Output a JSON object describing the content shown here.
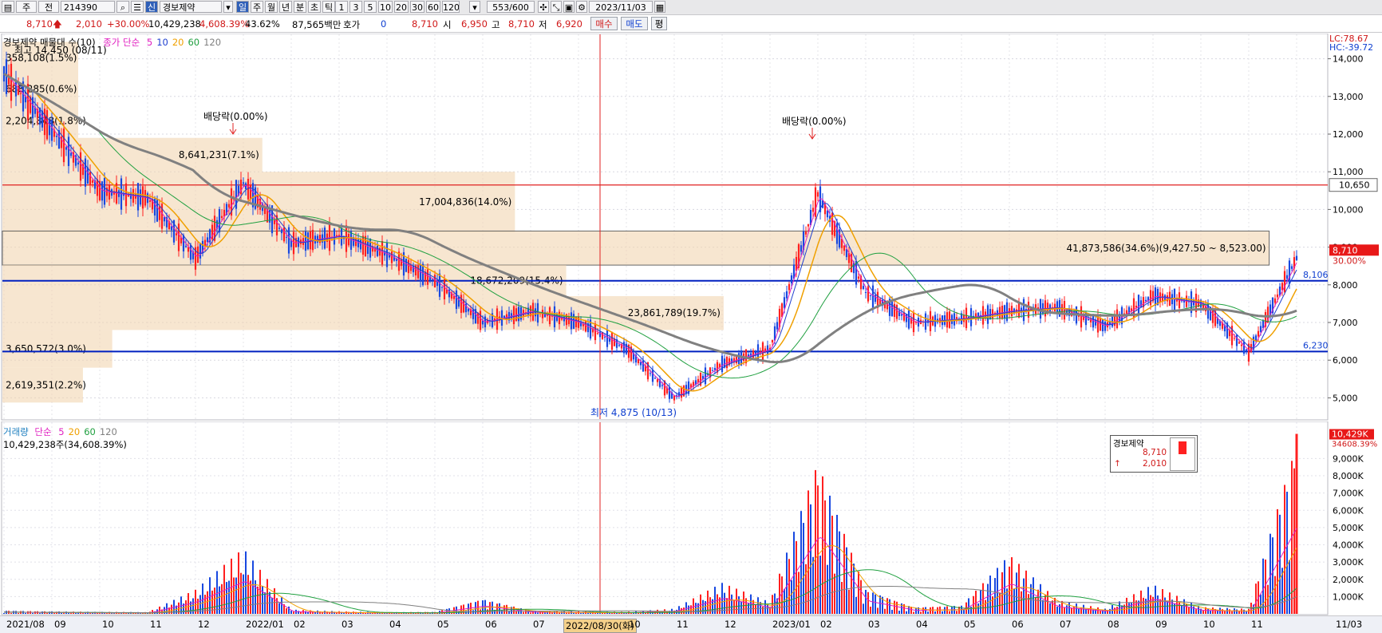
{
  "toolbar": {
    "main_label": "주",
    "jeon_label": "전",
    "code": "214390",
    "shin_label": "신",
    "stock_name": "경보제약",
    "periods": [
      "일",
      "주",
      "월",
      "년",
      "분",
      "초",
      "틱"
    ],
    "period_selected": "일",
    "intervals": [
      "1",
      "3",
      "5",
      "10",
      "20",
      "30",
      "60",
      "120"
    ],
    "count": "553/600",
    "date": "2023/11/03"
  },
  "quote": {
    "price": "8,710",
    "change": "2,010",
    "change_pct": "+30.00%",
    "volume": "10,429,238",
    "volume_pct": "4,608.39%",
    "turnover_pct": "43.62%",
    "amount": "87,565백만",
    "hoga_label": "호가",
    "hoga_value": "0",
    "hoga_price": "8,710",
    "open_label": "시",
    "open": "6,950",
    "high_label": "고",
    "high": "8,710",
    "low_label": "저",
    "low": "6,920",
    "buy_label": "매수",
    "sell_label": "매도",
    "eval_label": "평"
  },
  "price_panel": {
    "title": "경보제약 매물대 수(10)",
    "ma_label": "종가 단순",
    "ma_periods": [
      "5",
      "10",
      "20",
      "60",
      "120"
    ],
    "ma_colors": [
      "#e020c0",
      "#2040d0",
      "#f0a000",
      "#20a040",
      "#808080"
    ],
    "lc": "LC:78.67",
    "hc": "HC:-39.72",
    "max_label": "최고 14,450 (08/11)",
    "min_label": "최저 4,875 (10/13)",
    "dividend1": "배당락(0.00%)",
    "dividend2": "배당락(0.00%)",
    "cursor_price": "10,650",
    "current_price": "8,710",
    "current_pct": "30.00%",
    "level_upper": "8,106",
    "level_lower": "6,230",
    "y_ticks": [
      "14,000",
      "13,000",
      "12,000",
      "11,000",
      "10,000",
      "9,000",
      "8,000",
      "7,000",
      "6,000",
      "5,000"
    ],
    "volume_profile": [
      {
        "label": "358,108(1.5%)"
      },
      {
        "label": "688,285(0.6%)"
      },
      {
        "label": "2,204,848(1.8%)"
      },
      {
        "label": "8,641,231(7.1%)"
      },
      {
        "label": "17,004,836(14.0%)"
      },
      {
        "label": "41,873,586(34.6%)(9,427.50 ~ 8,523.00)"
      },
      {
        "label": "18,672,209(15.4%)"
      },
      {
        "label": "23,861,789(19.7%)"
      },
      {
        "label": "3,650,572(3.0%)"
      },
      {
        "label": "2,619,351(2.2%)"
      }
    ]
  },
  "volume_panel": {
    "title": "거래량",
    "ma_label": "단순",
    "ma_periods": [
      "5",
      "20",
      "60",
      "120"
    ],
    "summary": "10,429,238주(34,608.39%)",
    "current": "10,429K",
    "current_pct": "34608.39%",
    "y_ticks": [
      "9,000K",
      "8,000K",
      "7,000K",
      "6,000K",
      "5,000K",
      "4,000K",
      "3,000K",
      "2,000K",
      "1,000K"
    ],
    "mini": {
      "name": "경보제약",
      "price": "8,710",
      "change": "2,010"
    }
  },
  "x_axis": {
    "labels": [
      "2021/08",
      "09",
      "10",
      "11",
      "12",
      "2022/01",
      "02",
      "03",
      "04",
      "05",
      "06",
      "07",
      "08",
      "2022/08/30(화)",
      "10",
      "11",
      "12",
      "2023/01",
      "02",
      "03",
      "04",
      "05",
      "06",
      "07",
      "08",
      "09",
      "10",
      "11",
      "11/03"
    ]
  },
  "chart_data": {
    "type": "line",
    "title": "경보제약",
    "y_range": [
      4500,
      14500
    ],
    "volume_range": [
      0,
      10500000
    ],
    "x": [
      "2021/08",
      "2021/09",
      "2021/10",
      "2021/11",
      "2021/12",
      "2022/01",
      "2022/02",
      "2022/03",
      "2022/04",
      "2022/05",
      "2022/06",
      "2022/07",
      "2022/08",
      "2022/09",
      "2022/10",
      "2022/11",
      "2022/12",
      "2023/01",
      "2023/02",
      "2023/03",
      "2023/04",
      "2023/05",
      "2023/06",
      "2023/07",
      "2023/08",
      "2023/09",
      "2023/10",
      "2023/11"
    ],
    "series": [
      {
        "name": "종가",
        "values": [
          13600,
          12100,
          10500,
          10300,
          8700,
          10700,
          9100,
          9300,
          8800,
          8100,
          7000,
          7300,
          7000,
          6300,
          5000,
          5900,
          6300,
          10400,
          7800,
          7000,
          7100,
          7300,
          7400,
          6900,
          7700,
          7500,
          6200,
          8710
        ]
      },
      {
        "name": "거래량",
        "values": [
          200000,
          150000,
          120000,
          100000,
          1400000,
          3800000,
          250000,
          150000,
          100000,
          120000,
          900000,
          200000,
          150000,
          120000,
          300000,
          1800000,
          700000,
          9100000,
          1500000,
          400000,
          500000,
          3500000,
          800000,
          300000,
          1700000,
          400000,
          300000,
          10429238
        ]
      }
    ],
    "volume_profile": [
      {
        "range": [
          13600,
          14450
        ],
        "pct": 1.5
      },
      {
        "range": [
          12800,
          13600
        ],
        "pct": 0.6
      },
      {
        "range": [
          11900,
          12800
        ],
        "pct": 1.8
      },
      {
        "range": [
          11000,
          11900
        ],
        "pct": 7.1
      },
      {
        "range": [
          9400,
          11000
        ],
        "pct": 14.0
      },
      {
        "range": [
          8523,
          9427.5
        ],
        "pct": 34.6
      },
      {
        "range": [
          7700,
          8523
        ],
        "pct": 15.4
      },
      {
        "range": [
          6800,
          7700
        ],
        "pct": 19.7
      },
      {
        "range": [
          5800,
          6800
        ],
        "pct": 3.0
      },
      {
        "range": [
          4875,
          5800
        ],
        "pct": 2.2
      }
    ]
  }
}
